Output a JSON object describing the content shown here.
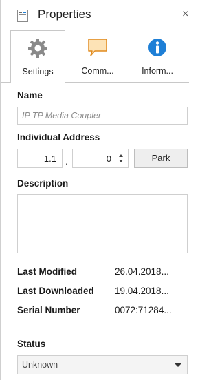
{
  "window": {
    "title": "Properties",
    "close_glyph": "×"
  },
  "tabs": [
    {
      "label": "Settings",
      "icon": "gear-icon",
      "active": true
    },
    {
      "label": "Comm...",
      "icon": "comment-icon",
      "active": false
    },
    {
      "label": "Inform...",
      "icon": "info-icon",
      "active": false
    }
  ],
  "name": {
    "label": "Name",
    "placeholder": "IP TP Media Coupler"
  },
  "address": {
    "label": "Individual Address",
    "part1": "1.1",
    "separator": ".",
    "part2": "0",
    "park_label": "Park"
  },
  "description": {
    "label": "Description",
    "value": ""
  },
  "info": [
    {
      "key": "Last Modified",
      "value": "26.04.2018..."
    },
    {
      "key": "Last Downloaded",
      "value": "19.04.2018..."
    },
    {
      "key": "Serial Number",
      "value": "0072:71284..."
    }
  ],
  "status": {
    "label": "Status",
    "value": "Unknown"
  },
  "colors": {
    "info_blue": "#1e7fd6",
    "comment_orange": "#f0a030",
    "gear_gray": "#8a8a8a"
  }
}
